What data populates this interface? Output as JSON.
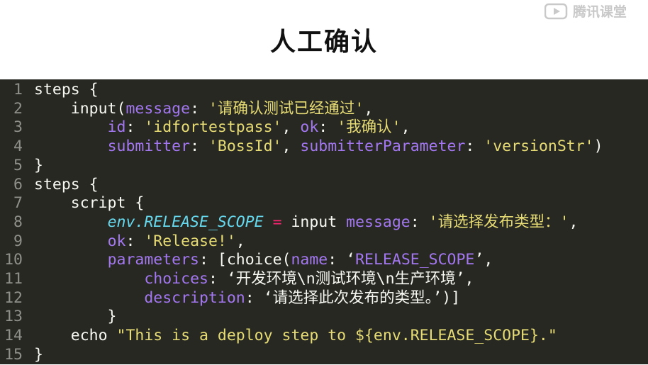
{
  "header": {
    "title": "人工确认",
    "watermark": "腾讯课堂"
  },
  "colors": {
    "background": "#272822",
    "plain": "#f8f8f2",
    "key": "#a377f0",
    "string": "#e6db74",
    "variable": "#66d9ef",
    "operator": "#f92672",
    "line_number": "#8f908a"
  },
  "code": {
    "lines": [
      {
        "n": "1",
        "tokens": [
          {
            "t": "steps {",
            "c": "pl"
          }
        ]
      },
      {
        "n": "2",
        "tokens": [
          {
            "t": "    input(",
            "c": "pl"
          },
          {
            "t": "message",
            "c": "key"
          },
          {
            "t": ": ",
            "c": "pl"
          },
          {
            "t": "'请确认测试已经通过'",
            "c": "str"
          },
          {
            "t": ",",
            "c": "pl"
          }
        ]
      },
      {
        "n": "3",
        "tokens": [
          {
            "t": "        ",
            "c": "pl"
          },
          {
            "t": "id",
            "c": "key"
          },
          {
            "t": ": ",
            "c": "pl"
          },
          {
            "t": "'idfortestpass'",
            "c": "str"
          },
          {
            "t": ", ",
            "c": "pl"
          },
          {
            "t": "ok",
            "c": "key"
          },
          {
            "t": ": ",
            "c": "pl"
          },
          {
            "t": "'我确认'",
            "c": "str"
          },
          {
            "t": ",",
            "c": "pl"
          }
        ]
      },
      {
        "n": "4",
        "tokens": [
          {
            "t": "        ",
            "c": "pl"
          },
          {
            "t": "submitter",
            "c": "key"
          },
          {
            "t": ": ",
            "c": "pl"
          },
          {
            "t": "'BossId'",
            "c": "str"
          },
          {
            "t": ", ",
            "c": "pl"
          },
          {
            "t": "submitterParameter",
            "c": "key"
          },
          {
            "t": ": ",
            "c": "pl"
          },
          {
            "t": "'versionStr'",
            "c": "str"
          },
          {
            "t": ")",
            "c": "pl"
          }
        ]
      },
      {
        "n": "5",
        "tokens": [
          {
            "t": "}",
            "c": "pl"
          }
        ]
      },
      {
        "n": "6",
        "tokens": [
          {
            "t": "steps {",
            "c": "pl"
          }
        ]
      },
      {
        "n": "7",
        "tokens": [
          {
            "t": "    script {",
            "c": "pl"
          }
        ]
      },
      {
        "n": "8",
        "tokens": [
          {
            "t": "        ",
            "c": "pl"
          },
          {
            "t": "env.RELEASE_SCOPE",
            "c": "var"
          },
          {
            "t": " ",
            "c": "pl"
          },
          {
            "t": "=",
            "c": "op"
          },
          {
            "t": " input ",
            "c": "pl"
          },
          {
            "t": "message",
            "c": "key"
          },
          {
            "t": ": ",
            "c": "pl"
          },
          {
            "t": "'请选择发布类型：'",
            "c": "str"
          },
          {
            "t": ",",
            "c": "pl"
          }
        ]
      },
      {
        "n": "9",
        "tokens": [
          {
            "t": "        ",
            "c": "pl"
          },
          {
            "t": "ok",
            "c": "key"
          },
          {
            "t": ": ",
            "c": "pl"
          },
          {
            "t": "'Release!'",
            "c": "str"
          },
          {
            "t": ",",
            "c": "pl"
          }
        ]
      },
      {
        "n": "10",
        "tokens": [
          {
            "t": "        ",
            "c": "pl"
          },
          {
            "t": "parameters",
            "c": "key"
          },
          {
            "t": ": [choice(",
            "c": "pl"
          },
          {
            "t": "name",
            "c": "key"
          },
          {
            "t": ": ‘",
            "c": "pl"
          },
          {
            "t": "RELEASE_SCOPE",
            "c": "key"
          },
          {
            "t": "’,",
            "c": "pl"
          }
        ]
      },
      {
        "n": "11",
        "tokens": [
          {
            "t": "            ",
            "c": "pl"
          },
          {
            "t": "choices",
            "c": "key"
          },
          {
            "t": ": ‘开发环境\\n测试环境\\n生产环境’,",
            "c": "pl"
          }
        ]
      },
      {
        "n": "12",
        "tokens": [
          {
            "t": "            ",
            "c": "pl"
          },
          {
            "t": "description",
            "c": "key"
          },
          {
            "t": ": ‘请选择此次发布的类型。’)]",
            "c": "pl"
          }
        ]
      },
      {
        "n": "13",
        "tokens": [
          {
            "t": "        }",
            "c": "pl"
          }
        ]
      },
      {
        "n": "14",
        "tokens": [
          {
            "t": "    echo ",
            "c": "pl"
          },
          {
            "t": "\"This is a deploy step to ${env.RELEASE_SCOPE}.\"",
            "c": "str"
          }
        ]
      },
      {
        "n": "15",
        "tokens": [
          {
            "t": "}",
            "c": "pl"
          }
        ]
      }
    ]
  }
}
